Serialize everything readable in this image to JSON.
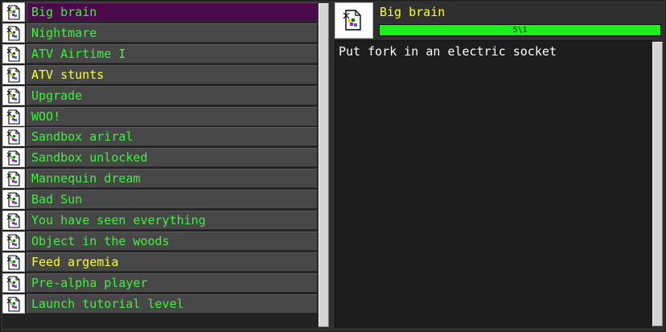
{
  "achievements": [
    {
      "label": "Big brain",
      "status": "selected",
      "color": "#3df23d"
    },
    {
      "label": "Nightmare",
      "status": "normal",
      "color": "#3df23d"
    },
    {
      "label": "ATV Airtime I",
      "status": "normal",
      "color": "#3df23d"
    },
    {
      "label": "ATV stunts",
      "status": "normal",
      "color": "#ffff20"
    },
    {
      "label": "Upgrade",
      "status": "normal",
      "color": "#3df23d"
    },
    {
      "label": "WOO!",
      "status": "normal",
      "color": "#3df23d"
    },
    {
      "label": "Sandbox ariral",
      "status": "normal",
      "color": "#3df23d"
    },
    {
      "label": "Sandbox unlocked",
      "status": "normal",
      "color": "#3df23d"
    },
    {
      "label": "Mannequin dream",
      "status": "normal",
      "color": "#3df23d"
    },
    {
      "label": "Bad Sun",
      "status": "normal",
      "color": "#3df23d"
    },
    {
      "label": "You have seen everything",
      "status": "normal",
      "color": "#3df23d"
    },
    {
      "label": "Object in the woods",
      "status": "normal",
      "color": "#3df23d"
    },
    {
      "label": "Feed argemia",
      "status": "normal",
      "color": "#ffff20"
    },
    {
      "label": "Pre-alpha player",
      "status": "normal",
      "color": "#3df23d"
    },
    {
      "label": "Launch tutorial level",
      "status": "normal",
      "color": "#3df23d"
    }
  ],
  "detail": {
    "title": "Big brain",
    "progress_text": "5\\1",
    "progress_fraction": 1.0,
    "description": "Put fork in an electric socket"
  },
  "icons": {
    "list_item": "missing-image-icon",
    "detail": "missing-image-icon"
  },
  "colors": {
    "selected_row": "#4c0a4c",
    "progress_fill": "#1cf01c",
    "title": "#ffff20"
  }
}
